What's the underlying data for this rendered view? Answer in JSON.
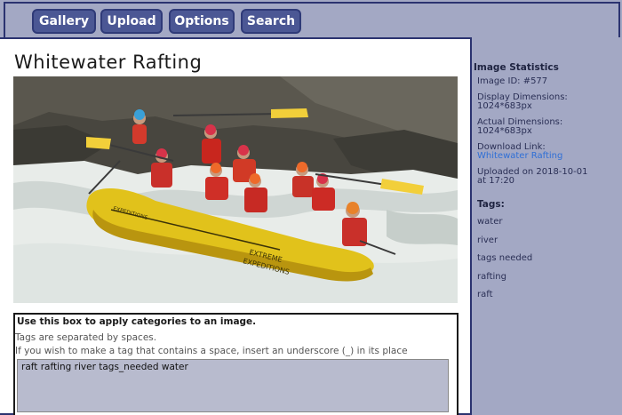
{
  "nav": {
    "gallery": "Gallery",
    "upload": "Upload",
    "options": "Options",
    "search": "Search"
  },
  "page": {
    "title": "Whitewater Rafting"
  },
  "tag_editor": {
    "heading": "Use this box to apply categories to an image.",
    "help_line1": "Tags are separated by spaces.",
    "help_line2": "If you wish to make a tag that contains a space, insert an underscore (_) in its place",
    "value": "raft rafting river tags_needed water"
  },
  "stats": {
    "heading": "Image Statistics",
    "image_id": "Image ID: #577",
    "display_dims_label": "Display Dimensions:",
    "display_dims_value": "1024*683px",
    "actual_dims_label": "Actual Dimensions:",
    "actual_dims_value": "1024*683px",
    "download_label": "Download Link:",
    "download_link": "Whitewater Rafting",
    "uploaded_line1": "Uploaded on 2018-10-01",
    "uploaded_line2": "at 17:20"
  },
  "tags": {
    "heading": "Tags:",
    "items": [
      "water",
      "river",
      "tags needed",
      "rafting",
      "raft"
    ]
  },
  "colors": {
    "nav_button": "#4b5794",
    "background": "#a3a8c4",
    "link": "#2f6fd6",
    "input_bg": "#b8bbce"
  }
}
